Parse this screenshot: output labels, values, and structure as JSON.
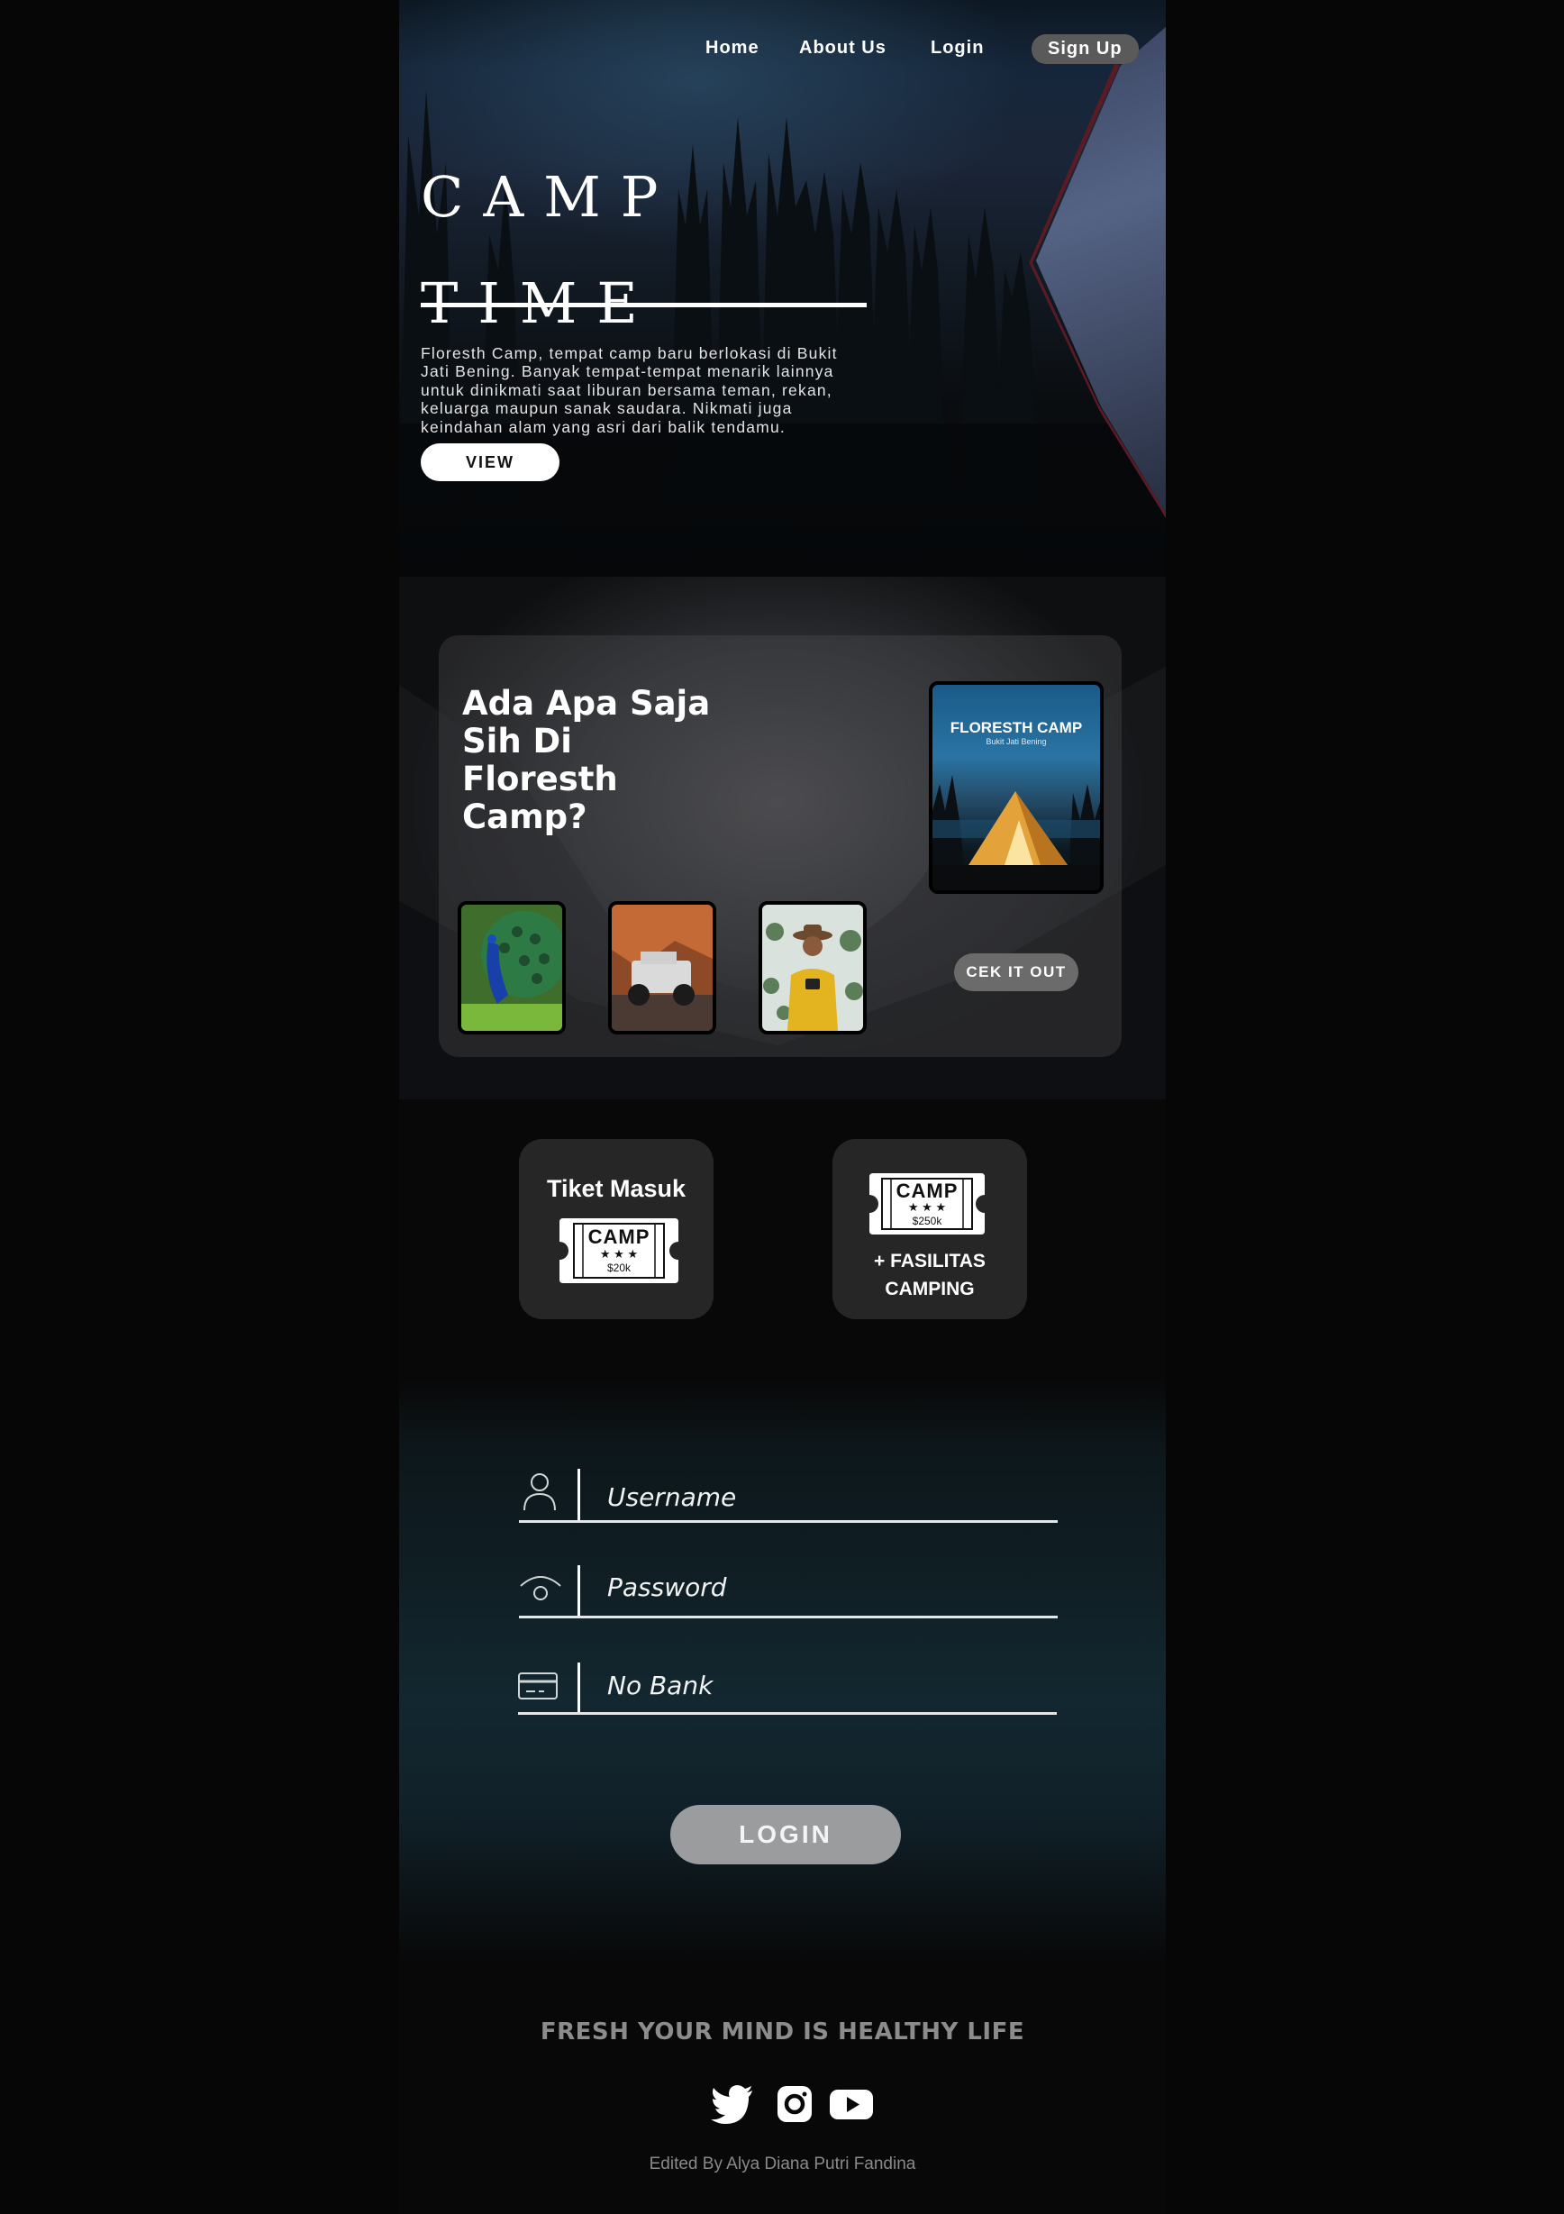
{
  "nav": {
    "items": [
      "Home",
      "About Us",
      "Login"
    ],
    "signup_label": "Sign Up"
  },
  "hero": {
    "title_line1": "CAMP",
    "title_line2": "TIME",
    "description": "Floresth Camp, tempat camp baru berlokasi di Bukit Jati Bening. Banyak tempat-tempat menarik lainnya untuk dinikmati saat liburan bersama teman, rekan, keluarga maupun sanak saudara. Nikmati juga keindahan alam yang asri dari balik tendamu.",
    "view_label": "VIEW"
  },
  "feature": {
    "title": "Ada Apa Saja Sih Di Floresth Camp?",
    "cover_title": "FLORESTH CAMP",
    "cover_subtitle": "Bukit Jati Bening",
    "cta_label": "CEK IT OUT"
  },
  "tickets": [
    {
      "label": "Tiket Masuk",
      "ticket_text": "CAMP",
      "ticket_price": "$20k"
    },
    {
      "label": "+ FASILITAS CAMPING",
      "ticket_text": "CAMP",
      "ticket_price": "$250k"
    }
  ],
  "login": {
    "username_placeholder": "Username",
    "password_placeholder": "Password",
    "bank_placeholder": "No Bank",
    "button_label": "LOGIN"
  },
  "footer": {
    "tagline": "FRESH YOUR MIND IS HEALTHY LIFE",
    "social_icons": [
      "twitter-icon",
      "instagram-icon",
      "youtube-icon"
    ],
    "credit": "Edited By Alya Diana Putri Fandina"
  },
  "colors": {
    "signup_bg": "#5a5a5a",
    "ticket_card_bg": "#262626",
    "login_button_bg": "#9a9c9e",
    "tagline": "#8c8c8c"
  }
}
